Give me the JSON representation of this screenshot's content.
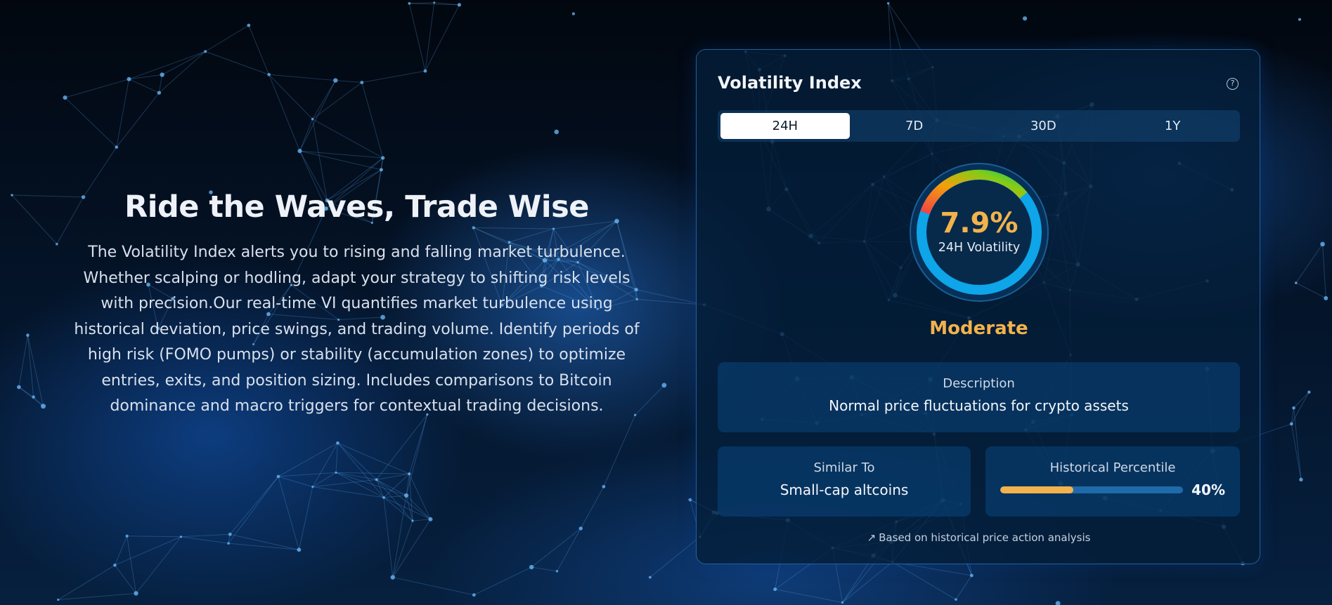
{
  "hero": {
    "title": "Ride the Waves, Trade Wise",
    "body": "The Volatility Index alerts you to rising and falling market turbulence. Whether scalping or hodling, adapt your strategy to shifting risk levels with precision.Our real-time VI quantifies market turbulence using historical deviation, price swings, and trading volume. Identify periods of high risk (FOMO pumps) or stability (accumulation zones) to optimize entries, exits, and position sizing. Includes comparisons to Bitcoin dominance and macro triggers for contextual trading decisions."
  },
  "card": {
    "title": "Volatility Index",
    "help_icon": "help-circle-icon",
    "tabs": [
      {
        "label": "24H",
        "active": true
      },
      {
        "label": "7D",
        "active": false
      },
      {
        "label": "30D",
        "active": false
      },
      {
        "label": "1Y",
        "active": false
      }
    ],
    "gauge": {
      "value_text": "7.9%",
      "value": 7.9,
      "label": "24H Volatility",
      "arc_colors": [
        "#ef4444",
        "#f59e0b",
        "#84cc16",
        "#22c55e"
      ],
      "track_color": "#0ea5e9"
    },
    "level": "Moderate",
    "description": {
      "label": "Description",
      "value": "Normal price fluctuations for crypto assets"
    },
    "similar_to": {
      "label": "Similar To",
      "value": "Small-cap altcoins"
    },
    "historical_percentile": {
      "label": "Historical Percentile",
      "value": 0.4,
      "value_text": "40%"
    },
    "footnote": {
      "icon": "trending-up-icon",
      "text": "Based on historical price action analysis"
    },
    "colors": {
      "accent": "#f2b24c",
      "panel": "#0a467d"
    }
  }
}
